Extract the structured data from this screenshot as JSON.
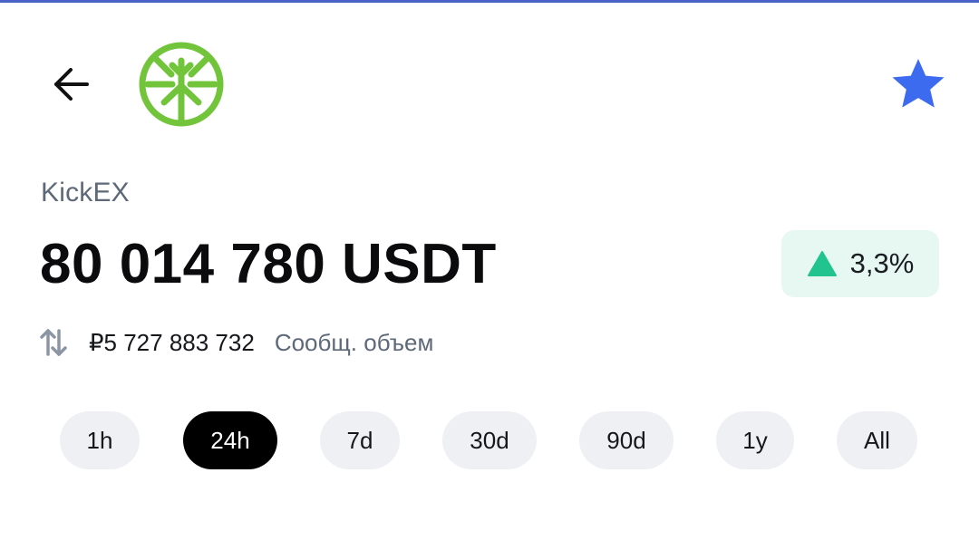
{
  "header": {
    "back_icon": "arrow-left-icon",
    "logo_icon": "kickex-logo-icon",
    "favorite_icon": "star-icon",
    "favorite_color": "#3d6bef"
  },
  "exchange": {
    "name": "KickEX",
    "volume": "80 014 780 USDT",
    "change": {
      "value": "3,3%",
      "direction_icon": "triangle-up-icon",
      "color": "#21c48f"
    },
    "sub_icon": "swap-vertical-icon",
    "fiat_volume": "₽5 727 883 732",
    "reported_label": "Сообщ. объем"
  },
  "periods": {
    "selected": "24h",
    "items": [
      {
        "label": "1h"
      },
      {
        "label": "24h"
      },
      {
        "label": "7d"
      },
      {
        "label": "30d"
      },
      {
        "label": "90d"
      },
      {
        "label": "1y"
      },
      {
        "label": "All"
      }
    ]
  }
}
